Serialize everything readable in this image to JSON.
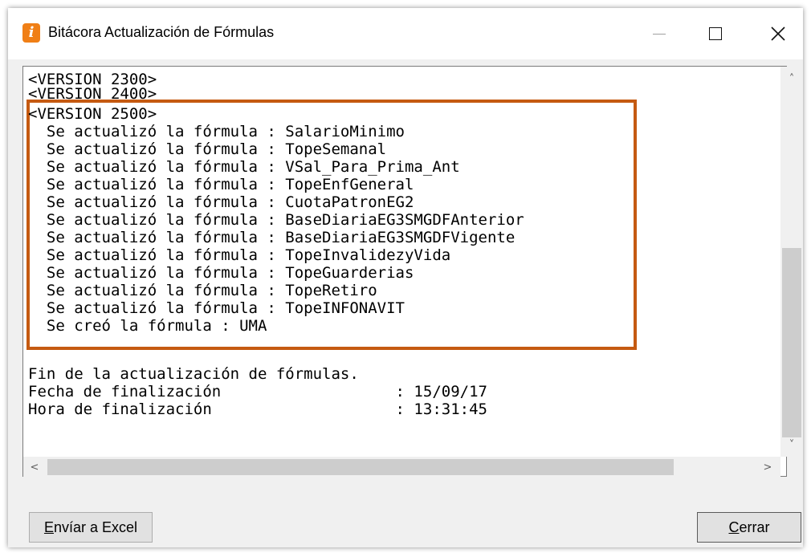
{
  "window": {
    "title": "Bitácora Actualización de Fórmulas",
    "app_icon_glyph": "i",
    "controls": [
      "minimize-icon",
      "maximize-icon",
      "close-icon"
    ],
    "accent_color": "#c55a11",
    "icon_color": "#f07f16"
  },
  "log": {
    "lines": [
      "<VERSION 2300>",
      "<VERSION 2400>",
      "<VERSION 2500>",
      "  Se actualizó la fórmula : SalarioMinimo",
      "  Se actualizó la fórmula : TopeSemanal",
      "  Se actualizó la fórmula : VSal_Para_Prima_Ant",
      "  Se actualizó la fórmula : TopeEnfGeneral",
      "  Se actualizó la fórmula : CuotaPatronEG2",
      "  Se actualizó la fórmula : BaseDiariaEG3SMGDFAnterior",
      "  Se actualizó la fórmula : BaseDiariaEG3SMGDFVigente",
      "  Se actualizó la fórmula : TopeInvalidezyVida",
      "  Se actualizó la fórmula : TopeGuarderias",
      "  Se actualizó la fórmula : TopeRetiro",
      "  Se actualizó la fórmula : TopeINFONAVIT",
      "  Se creó la fórmula : UMA",
      "",
      "",
      "Fin de la actualización de fórmulas.",
      "Fecha de finalización                   : 15/09/17",
      "Hora de finalización                    : 13:31:45"
    ]
  },
  "scrollbars": {
    "up_arrow": "˄",
    "down_arrow": "˅",
    "left_arrow": "<",
    "right_arrow": ">"
  },
  "buttons": {
    "excel": {
      "underline": "E",
      "rest": "nvíar a Excel"
    },
    "close": {
      "underline": "C",
      "rest": "errar"
    }
  }
}
